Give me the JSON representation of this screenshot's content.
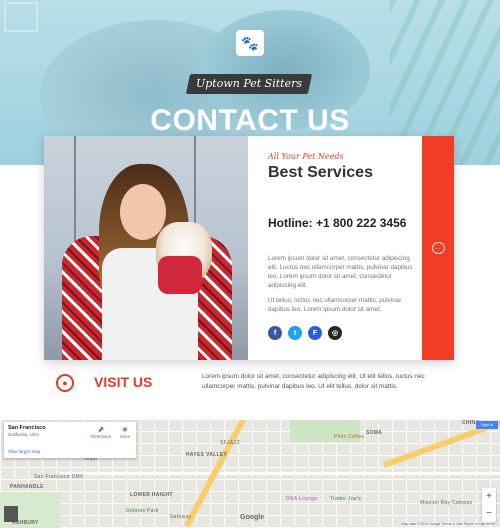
{
  "hero": {
    "tagline": "Uptown Pet Sitters",
    "title": "CONTACT US"
  },
  "services": {
    "kicker": "All Your Pet Needs",
    "title": "Best Services",
    "hotline": "Hotline: +1 800 222 3456",
    "paragraph1": "Lorem ipsum dolor sit amet, consectetur adipiscing elit. Luctus nec ullamcorper mattis, pulvinar dapibus leo. Lorem ipsum dolor sit amet, consectetur adipiscing elit.",
    "paragraph2": "Ut tellus, luctus nec ullamcorper mattis, pulvinar dapibus leo. Lorem ipsum dolor sit amet.",
    "socials": [
      {
        "name": "facebook",
        "glyph": "f",
        "color": "#3b5998"
      },
      {
        "name": "twitter",
        "glyph": "t",
        "color": "#1da1f2"
      },
      {
        "name": "foursquare",
        "glyph": "F",
        "color": "#2d5be3"
      },
      {
        "name": "instagram",
        "glyph": "◎",
        "color": "#262626"
      }
    ]
  },
  "visit": {
    "title": "VISIT US",
    "text": "Lorem ipsum dolor sit amet, consectetur adipiscing elit. Ut elit tellus, luctus nec ullamcorper mattis, pulvinar dapibus leo. Ut elit tellus, dolor sit mattis."
  },
  "map": {
    "place_title": "San Francisco",
    "place_sub": "California, USA",
    "larger_map_link": "View larger map",
    "directions_label": "Directions",
    "save_label": "Save",
    "sign_in_label": "Sign in",
    "google": "Google",
    "footer": "Map data ©2019 Google   Terms of Use   Report a map error",
    "labels": [
      "HAYES VALLEY",
      "LOWER HAIGHT",
      "PANHANDLE",
      "SOMA",
      "CHINA",
      "ASHBURY",
      "San Francisco DMV",
      "SFJAZZ",
      "Philz Coffee",
      "Dolores Park",
      "DNA Lounge",
      "Trader Joe's",
      "Mission Bay Campus",
      "Safeway",
      "Nopa"
    ]
  },
  "colors": {
    "accent": "#e5392b",
    "accent_bar": "#f23c25"
  }
}
